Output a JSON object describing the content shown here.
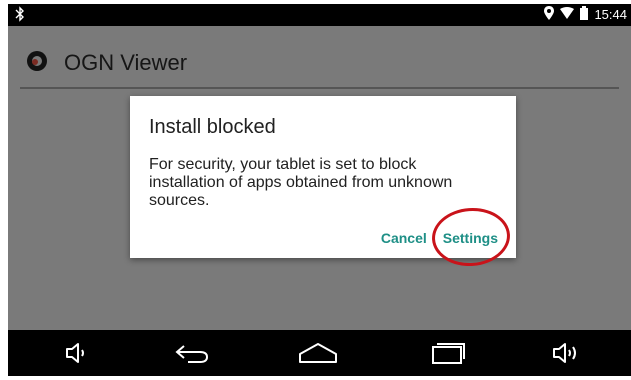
{
  "status_bar": {
    "time": "15:44",
    "icons": [
      "bluetooth-icon",
      "location-icon",
      "wifi-icon",
      "battery-icon"
    ]
  },
  "app": {
    "title": "OGN Viewer",
    "logo_icon": "ogn-logo-icon"
  },
  "dialog": {
    "title": "Install blocked",
    "message": "For security, your tablet is set to block installation of apps obtained from unknown sources.",
    "cancel_label": "Cancel",
    "settings_label": "Settings"
  },
  "nav_bar": {
    "icons": [
      "volume-down-icon",
      "back-icon",
      "home-icon",
      "recents-icon",
      "volume-up-icon"
    ]
  },
  "colors": {
    "accent": "#1e8f86",
    "annotation": "#c9131a",
    "scrim": "#7a7a7a"
  }
}
